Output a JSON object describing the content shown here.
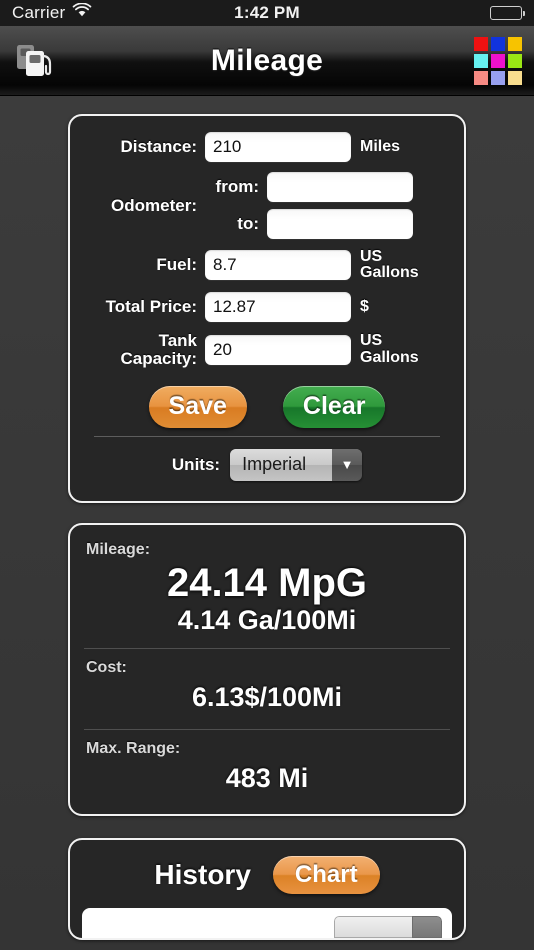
{
  "status_bar": {
    "carrier": "Carrier",
    "time": "1:42 PM",
    "wifi_icon": "wifi-icon",
    "battery_icon": "battery-full-icon"
  },
  "nav_bar": {
    "title": "Mileage",
    "left_icon": "gas-pump-icon",
    "right_icon": "color-grid-icon",
    "color_grid": [
      "#ee1111",
      "#1133dd",
      "#f7c300",
      "#66f0f0",
      "#ee11cc",
      "#9ae614",
      "#f78b84",
      "#98a0ef",
      "#f8dd8e"
    ]
  },
  "form": {
    "distance": {
      "label": "Distance:",
      "value": "210",
      "unit": "Miles"
    },
    "odometer": {
      "label": "Odometer:",
      "from_label": "from:",
      "from_value": "",
      "to_label": "to:",
      "to_value": ""
    },
    "fuel": {
      "label": "Fuel:",
      "value": "8.7",
      "unit": "US Gallons"
    },
    "total_price": {
      "label": "Total Price:",
      "value": "12.87",
      "unit": "$"
    },
    "tank_capacity": {
      "label": "Tank Capacity:",
      "value": "20",
      "unit": "US Gallons"
    },
    "save_button": "Save",
    "clear_button": "Clear",
    "units": {
      "label": "Units:",
      "selected": "Imperial",
      "arrow_icon": "chevron-down-icon"
    }
  },
  "results": {
    "mileage": {
      "label": "Mileage:",
      "primary": "24.14 MpG",
      "secondary": "4.14 Ga/100Mi"
    },
    "cost": {
      "label": "Cost:",
      "value": "6.13$/100Mi"
    },
    "max_range": {
      "label": "Max. Range:",
      "value": "483 Mi"
    }
  },
  "history": {
    "title": "History",
    "chart_button": "Chart"
  },
  "colors": {
    "accent_orange": "#e89340",
    "accent_green": "#2f9a3c",
    "panel_bg": "#262626",
    "page_bg": "#3a3a3a"
  }
}
